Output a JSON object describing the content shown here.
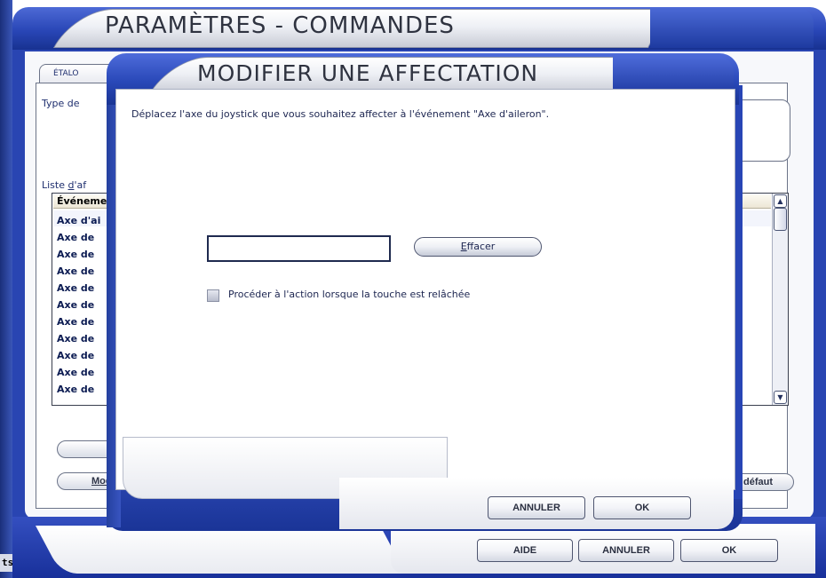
{
  "background_window": {
    "title": "PARAMÈTRES - COMMANDES",
    "tab_label": "ÉTALO",
    "type_label": "Type de",
    "list_label_prefix": "Liste ",
    "list_label_accel": "d",
    "list_label_suffix": "'af",
    "list_header": "Événeme",
    "list_rows": [
      "Axe d'ai",
      "Axe de",
      "Axe de",
      "Axe de",
      "Axe de",
      "Axe de",
      "Axe de",
      "Axe de",
      "Axe de",
      "Axe de",
      "Axe de"
    ],
    "button_modify_label": "Mod",
    "button_default_label": "défaut",
    "footer_buttons": {
      "help": "AIDE",
      "cancel": "ANNULER",
      "ok": "OK"
    },
    "side_label": "ts"
  },
  "dialog": {
    "title": "MODIFIER UNE AFFECTATION",
    "message": "Déplacez l'axe du joystick que vous souhaitez affecter à l'événement \"Axe d'aileron\".",
    "input_value": "",
    "clear_button_accel": "E",
    "clear_button_rest": "ffacer",
    "checkbox_label": "Procéder à l'action lorsque la touche est relâchée",
    "checkbox_checked": false,
    "buttons": {
      "cancel": "ANNULER",
      "ok": "OK"
    }
  }
}
